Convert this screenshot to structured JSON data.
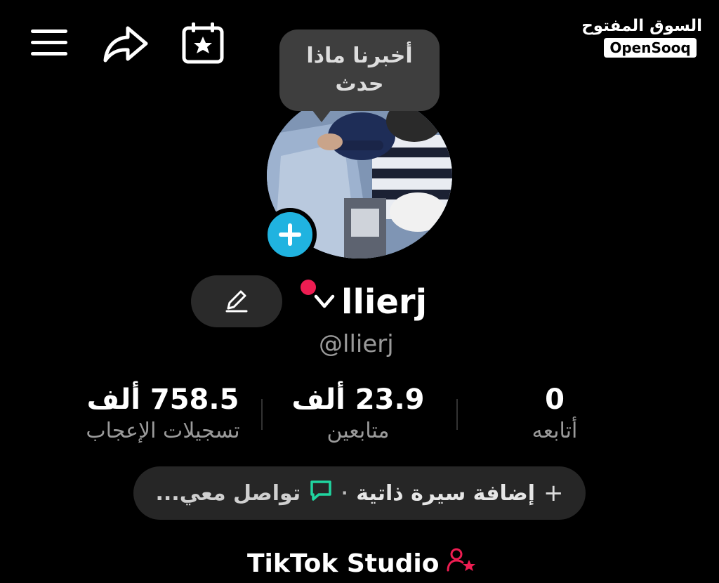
{
  "watermark": {
    "arabic": "السوق المفتوح",
    "english": "OpenSooq"
  },
  "topbar": {
    "menu_icon": "hamburger-menu-icon",
    "share_icon": "share-arrow-icon",
    "calendar_icon": "calendar-star-icon"
  },
  "tooltip": {
    "line1": "أخبرنا ماذا",
    "line2": "حدث"
  },
  "profile": {
    "display_name": "llierj",
    "username": "@llierj",
    "live_dot_color": "#ee1d52",
    "add_button_color": "#20b3e0"
  },
  "stats": {
    "likes": {
      "value": "758.5 ألف",
      "label": "تسجيلات الإعجاب"
    },
    "followers": {
      "value": "23.9 ألف",
      "label": "متابعين"
    },
    "following": {
      "value": "0",
      "label": "أتابعه"
    }
  },
  "bio": {
    "add_bio": "إضافة سيرة ذاتية",
    "separator": "·",
    "contact": "تواصل معي...",
    "chat_icon_color": "#20d5a0"
  },
  "studio": {
    "label": "TikTok Studio",
    "icon_color": "#ee1d52"
  }
}
